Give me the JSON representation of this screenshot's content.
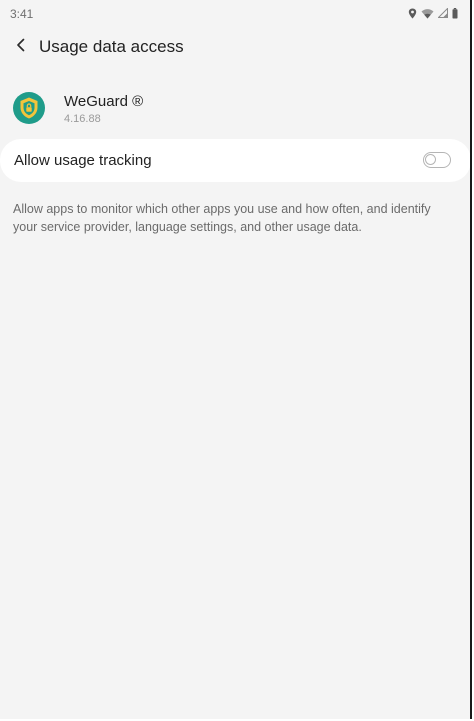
{
  "status_bar": {
    "time": "3:41",
    "icons": [
      "location-icon",
      "wifi-icon",
      "signal-icon",
      "battery-icon"
    ]
  },
  "header": {
    "back_icon": "chevron-left-icon",
    "title": "Usage data access"
  },
  "app": {
    "name": "WeGuard ®",
    "version": "4.16.88",
    "icon": "weguard-shield-icon"
  },
  "setting": {
    "label": "Allow usage tracking",
    "enabled": false
  },
  "description": "Allow apps to monitor which other apps you use and how often, and identify your service provider, language settings, and other usage data.",
  "colors": {
    "background": "#f4f4f4",
    "card": "#ffffff",
    "app_icon_teal": "#1f9c8a",
    "app_icon_yellow": "#f3c43b"
  }
}
